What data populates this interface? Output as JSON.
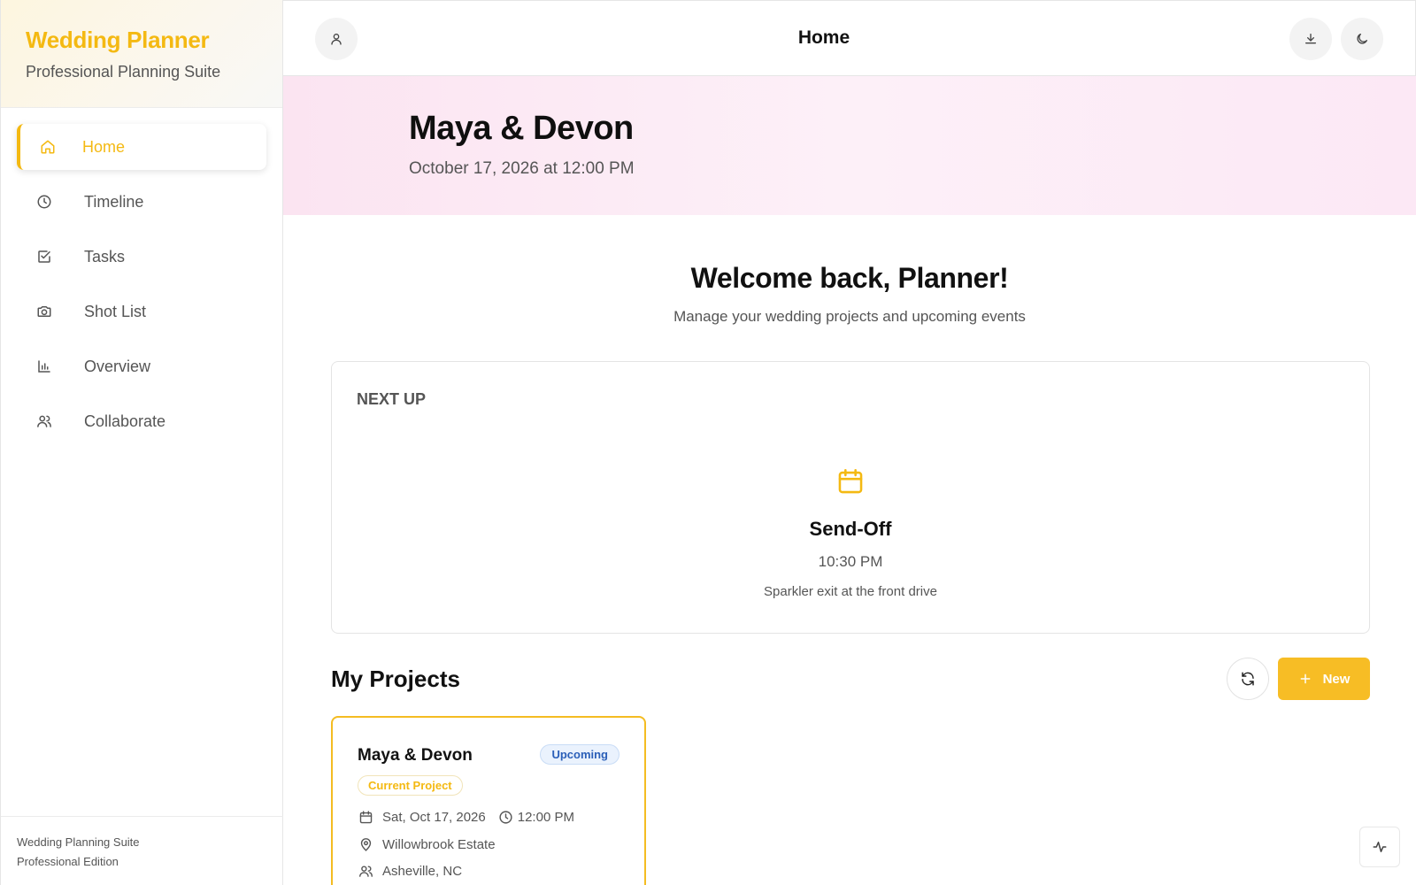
{
  "brand": {
    "title": "Wedding Planner",
    "subtitle": "Professional Planning Suite",
    "accent_color": "#f4b912"
  },
  "sidebar": {
    "items": [
      {
        "label": "Home",
        "icon": "home-icon",
        "active": true
      },
      {
        "label": "Timeline",
        "icon": "clock-icon",
        "active": false
      },
      {
        "label": "Tasks",
        "icon": "checkbox-icon",
        "active": false
      },
      {
        "label": "Shot List",
        "icon": "camera-icon",
        "active": false
      },
      {
        "label": "Overview",
        "icon": "bar-chart-icon",
        "active": false
      },
      {
        "label": "Collaborate",
        "icon": "users-icon",
        "active": false
      }
    ],
    "footer": {
      "line1": "Wedding Planning Suite",
      "line2": "Professional Edition"
    }
  },
  "topbar": {
    "title": "Home",
    "icons": [
      "user-icon",
      "download-icon",
      "moon-icon"
    ]
  },
  "hero": {
    "couple": "Maya & Devon",
    "date": "October 17, 2026 at 12:00 PM"
  },
  "main": {
    "welcome": "Welcome back, Planner!",
    "welcome_sub": "Manage your wedding projects and upcoming events"
  },
  "next_up": {
    "label": "NEXT UP",
    "icon": "calendar-icon",
    "title": "Send-Off",
    "time": "10:30 PM",
    "description": "Sparkler exit at the front drive"
  },
  "projects": {
    "title": "My Projects",
    "new_label": "New",
    "items": [
      {
        "name": "Maya & Devon",
        "status": "Upcoming",
        "tag": "Current Project",
        "date": "Sat, Oct 17, 2026",
        "time": "12:00 PM",
        "venue": "Willowbrook Estate",
        "location": "Asheville, NC"
      }
    ]
  }
}
